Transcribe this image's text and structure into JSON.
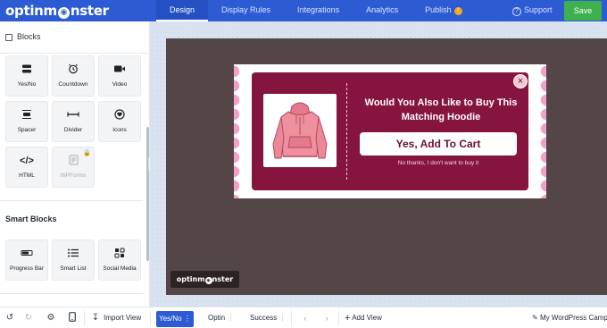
{
  "app": {
    "logo_text_before": "optinm",
    "logo_text_after": "nster",
    "brand_color": "#2d5bd4"
  },
  "nav": {
    "tabs": [
      "Design",
      "Display Rules",
      "Integrations",
      "Analytics",
      "Publish"
    ],
    "active_tab": "Design",
    "publish_badge": "!",
    "support_label": "Support",
    "save_label": "Save"
  },
  "sidebar": {
    "title": "Blocks",
    "blocks": [
      {
        "label": "Yes/No",
        "icon": "yes-no-icon"
      },
      {
        "label": "Countdown",
        "icon": "alarm-clock-icon"
      },
      {
        "label": "Video",
        "icon": "video-camera-icon"
      },
      {
        "label": "Spacer",
        "icon": "spacer-icon"
      },
      {
        "label": "Divider",
        "icon": "divider-icon"
      },
      {
        "label": "Icons",
        "icon": "heart-icon"
      },
      {
        "label": "HTML",
        "icon": "code-icon"
      },
      {
        "label": "WPForms",
        "icon": "wpforms-icon",
        "locked": true
      }
    ],
    "smart_title": "Smart Blocks",
    "smart_blocks": [
      {
        "label": "Progress Bar",
        "icon": "progress-bar-icon"
      },
      {
        "label": "Smart List",
        "icon": "list-icon"
      },
      {
        "label": "Social Media",
        "icon": "social-media-icon"
      }
    ]
  },
  "popup": {
    "headline": "Would You Also Like to Buy This Matching Hoodie",
    "cta_label": "Yes, Add To Cart",
    "decline_label": "No thanks, I don't want to buy it",
    "close_glyph": "×",
    "background_color": "#85143e",
    "product_image": "pink-hoodie"
  },
  "preview_badge": {
    "text_before": "optinm",
    "text_after": "nster"
  },
  "bottom": {
    "import_label": "Import View",
    "views": [
      "Yes/No",
      "Optin",
      "Success"
    ],
    "active_view": "Yes/No",
    "add_view_label": "Add View",
    "campaign_label": "My WordPress Camp"
  }
}
